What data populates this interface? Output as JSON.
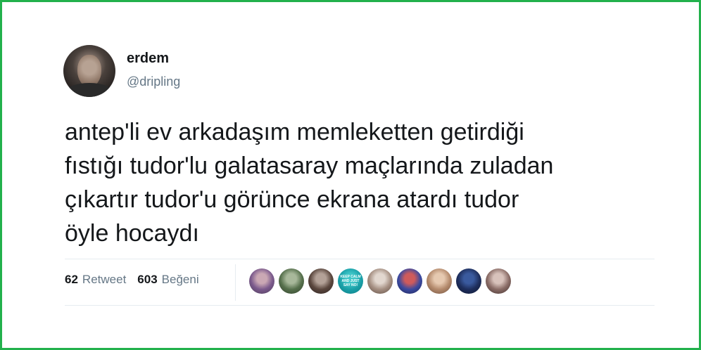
{
  "user": {
    "name": "erdem",
    "handle": "@dripling"
  },
  "tweet": {
    "text": "antep'li ev arkadaşım memleketten getirdiği\nfıstığı tudor'lu galatasaray maçlarında zuladan\nçıkartır tudor'u görünce ekrana atardı tudor\nöyle hocaydı"
  },
  "stats": {
    "retweet_count": "62",
    "retweet_label": "Retweet",
    "like_count": "603",
    "like_label": "Beğeni"
  },
  "likers": [
    {
      "colors": [
        "#caa8b4",
        "#7b5a8c",
        "#4a3a56"
      ]
    },
    {
      "colors": [
        "#a8b89a",
        "#56704c",
        "#2f3f2a"
      ]
    },
    {
      "colors": [
        "#b3a197",
        "#5a463d",
        "#2b2220"
      ]
    },
    {
      "colors": [
        "#3fc6c8",
        "#1aa0a8",
        "#0b7b82"
      ],
      "text": "KEEP CALM AND JUST SAY NO!"
    },
    {
      "colors": [
        "#e2d7cf",
        "#a58f82",
        "#5c4a40"
      ]
    },
    {
      "colors": [
        "#cf5b5b",
        "#3b4aa0",
        "#1b2050"
      ]
    },
    {
      "colors": [
        "#e6c9b0",
        "#b48a6c",
        "#6d4f3d"
      ]
    },
    {
      "colors": [
        "#3a5a9e",
        "#1e2e5c",
        "#0e1730"
      ]
    },
    {
      "colors": [
        "#d8c2bb",
        "#8a6c66",
        "#3e2e2c"
      ]
    }
  ]
}
